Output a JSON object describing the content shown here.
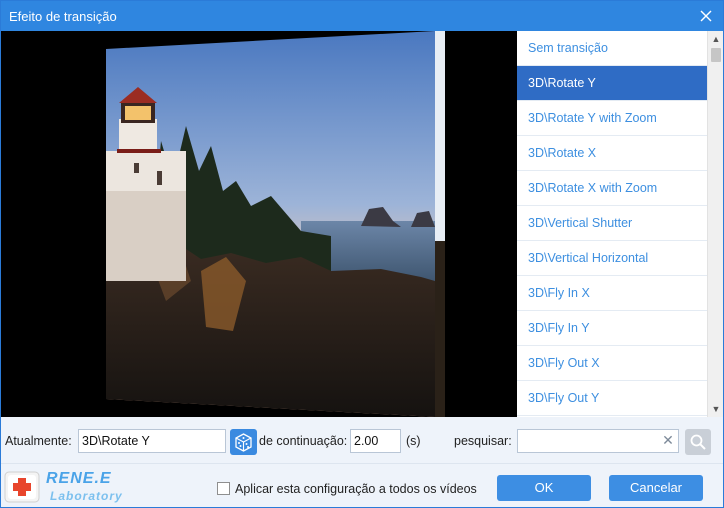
{
  "window": {
    "title": "Efeito de transição"
  },
  "transitions": [
    {
      "label": "Sem transição",
      "selected": false
    },
    {
      "label": "3D\\Rotate Y",
      "selected": true
    },
    {
      "label": "3D\\Rotate Y with Zoom",
      "selected": false
    },
    {
      "label": "3D\\Rotate X",
      "selected": false
    },
    {
      "label": "3D\\Rotate X with Zoom",
      "selected": false
    },
    {
      "label": "3D\\Vertical Shutter",
      "selected": false
    },
    {
      "label": "3D\\Vertical Horizontal",
      "selected": false
    },
    {
      "label": "3D\\Fly In X",
      "selected": false
    },
    {
      "label": "3D\\Fly In Y",
      "selected": false
    },
    {
      "label": "3D\\Fly Out X",
      "selected": false
    },
    {
      "label": "3D\\Fly Out Y",
      "selected": false
    }
  ],
  "controls": {
    "current_label": "Atualmente:",
    "current_value": "3D\\Rotate Y",
    "duration_label": "de continuação:",
    "duration_value": "2.00",
    "duration_unit": "(s)",
    "search_label": "pesquisar:",
    "search_value": ""
  },
  "footer": {
    "logo_name": "RENE.E",
    "logo_sub": "Laboratory",
    "apply_all_label": "Aplicar esta configuração a todos os vídeos",
    "apply_all_checked": false,
    "ok_label": "OK",
    "cancel_label": "Cancelar"
  },
  "icons": {
    "close": "close-icon",
    "random": "dice-icon",
    "clear": "clear-icon",
    "search": "search-icon",
    "logo": "rene-logo-icon"
  },
  "colors": {
    "titlebar": "#2f86e0",
    "selected_item": "#2f6cc5",
    "item_text": "#3d8fe0",
    "button": "#3d8ee3"
  }
}
